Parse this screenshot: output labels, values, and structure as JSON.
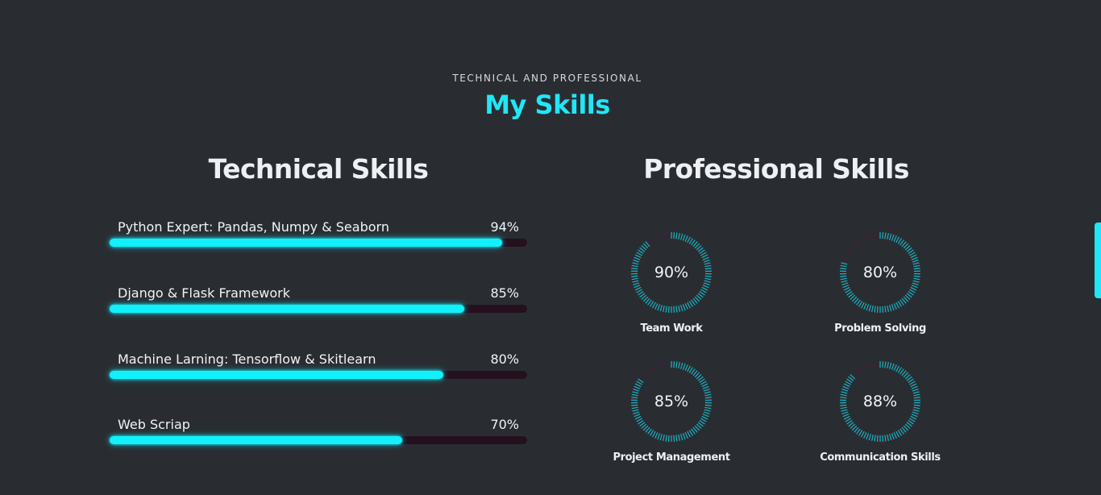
{
  "header": {
    "subtitle": "TECHNICAL AND PROFESSIONAL",
    "title": "My Skills"
  },
  "technical": {
    "heading": "Technical Skills",
    "skills": [
      {
        "label": "Python Expert: Pandas, Numpy & Seaborn",
        "percent_text": "94%",
        "level": 0.94
      },
      {
        "label": "Django & Flask Framework",
        "percent_text": "85%",
        "level": 0.85
      },
      {
        "label": "Machine Larning: Tensorflow & Skitlearn",
        "percent_text": "80%",
        "level": 0.8
      },
      {
        "label": "Web Scriap",
        "percent_text": "70%",
        "level": 0.7
      }
    ]
  },
  "professional": {
    "heading": "Professional Skills",
    "skills": [
      {
        "label": "Team Work",
        "percent_text": "90%",
        "level": 0.9
      },
      {
        "label": "Problem Solving",
        "percent_text": "80%",
        "level": 0.8
      },
      {
        "label": "Project Management",
        "percent_text": "85%",
        "level": 0.85
      },
      {
        "label": "Communication Skills",
        "percent_text": "88%",
        "level": 0.88
      }
    ]
  },
  "colors": {
    "accent": "#21e6f6",
    "bar_fill": "#12f0fb",
    "bar_track": "#25101f",
    "ring_fill": "#1bb3c2",
    "ring_track": "#3a2233",
    "background": "#292d32"
  }
}
